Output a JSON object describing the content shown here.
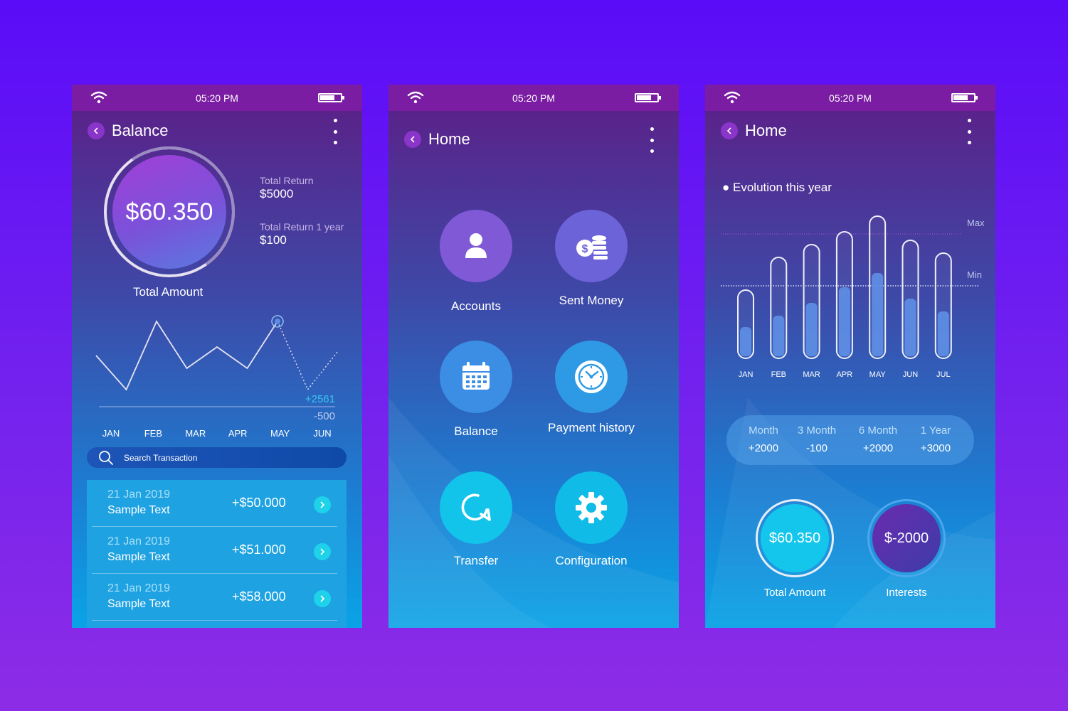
{
  "status": {
    "time": "05:20 PM"
  },
  "balance_screen": {
    "title": "Balance",
    "amount": "$60.350",
    "amount_label": "Total Amount",
    "total_return_label": "Total Return",
    "total_return_value": "$5000",
    "total_return_year_label": "Total Return 1 year",
    "total_return_year_value": "$100",
    "chart_plus": "+2561",
    "chart_minus": "-500",
    "months": [
      "JAN",
      "FEB",
      "MAR",
      "APR",
      "MAY",
      "JUN"
    ],
    "search_placeholder": "Search Transaction",
    "transactions": [
      {
        "date": "21 Jan 2019",
        "text": "Sample Text",
        "amount": "+$50.000"
      },
      {
        "date": "21 Jan 2019",
        "text": "Sample Text",
        "amount": "+$51.000"
      },
      {
        "date": "21 Jan 2019",
        "text": "Sample Text",
        "amount": "+$58.000"
      }
    ]
  },
  "home_menu_screen": {
    "title": "Home",
    "tiles": [
      {
        "label": "Accounts",
        "icon": "user-icon",
        "color": "#7f59d6"
      },
      {
        "label": "Sent Money",
        "icon": "coins-icon",
        "color": "#6d63d9"
      },
      {
        "label": "Balance",
        "icon": "calendar-icon",
        "color": "#3b8ee4"
      },
      {
        "label": "Payment history",
        "icon": "clock-icon",
        "color": "#2e9ae6"
      },
      {
        "label": "Transfer",
        "icon": "refresh-icon",
        "color": "#12c3ea"
      },
      {
        "label": "Configuration",
        "icon": "gear-icon",
        "color": "#10bbe8"
      }
    ]
  },
  "home_stats_screen": {
    "title": "Home",
    "chart_title": "Evolution this year",
    "max_label": "Max",
    "min_label": "Min",
    "ranges": [
      {
        "label": "Month",
        "value": "+2000"
      },
      {
        "label": "3 Month",
        "value": "-100"
      },
      {
        "label": "6 Month",
        "value": "+2000"
      },
      {
        "label": "1 Year",
        "value": "+3000"
      }
    ],
    "total_amount_value": "$60.350",
    "total_amount_label": "Total Amount",
    "interests_value": "$-2000",
    "interests_label": "Interests"
  },
  "chart_data": [
    {
      "type": "line",
      "categories": [
        "JAN",
        "FEB",
        "MAR",
        "APR",
        "MAY",
        "JUN"
      ],
      "series": [
        {
          "values": [
            0.45,
            0.05,
            0.85,
            0.3,
            0.55,
            0.3,
            0.85,
            0.05,
            0.5
          ]
        }
      ],
      "annotations": [
        "+2561",
        "-500"
      ],
      "grid": false
    },
    {
      "type": "bar",
      "title": "Evolution this year",
      "categories": [
        "JAN",
        "FEB",
        "MAR",
        "APR",
        "MAY",
        "JUN",
        "JUL"
      ],
      "capacity": [
        0.48,
        0.71,
        0.8,
        0.89,
        1.0,
        0.83,
        0.74
      ],
      "values": [
        0.22,
        0.3,
        0.39,
        0.5,
        0.6,
        0.42,
        0.33
      ],
      "reference_lines": [
        "Max",
        "Min"
      ],
      "grid": false
    }
  ]
}
